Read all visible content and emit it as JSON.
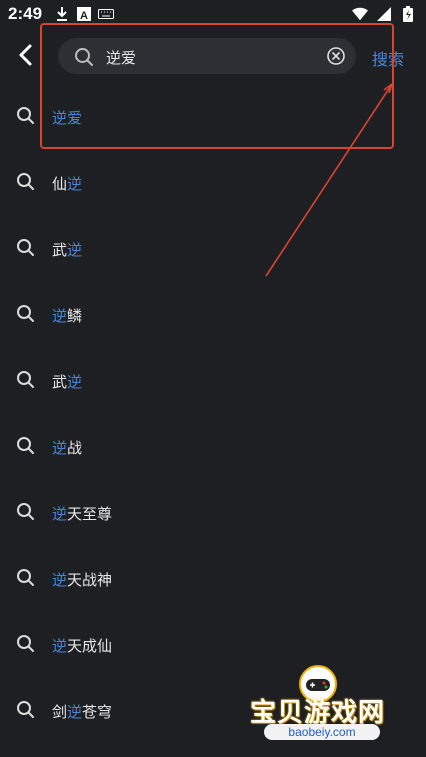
{
  "status": {
    "time": "2:49"
  },
  "search": {
    "value": "逆爱",
    "button_label": "搜索"
  },
  "suggestions": [
    {
      "prefix": "",
      "match": "逆爱",
      "suffix": ""
    },
    {
      "prefix": "仙",
      "match": "逆",
      "suffix": ""
    },
    {
      "prefix": "武",
      "match": "逆",
      "suffix": ""
    },
    {
      "prefix": "",
      "match": "逆",
      "suffix": "鳞"
    },
    {
      "prefix": "武",
      "match": "逆",
      "suffix": ""
    },
    {
      "prefix": "",
      "match": "逆",
      "suffix": "战"
    },
    {
      "prefix": "",
      "match": "逆",
      "suffix": "天至尊"
    },
    {
      "prefix": "",
      "match": "逆",
      "suffix": "天战神"
    },
    {
      "prefix": "",
      "match": "逆",
      "suffix": "天成仙"
    },
    {
      "prefix": "剑",
      "match": "逆",
      "suffix": "苍穹"
    }
  ],
  "watermark": {
    "title": "宝贝游戏网",
    "url": "baobeiy.com"
  },
  "colors": {
    "background": "#1e1f23",
    "accent": "#4a86d6",
    "annotation": "#d9442f"
  }
}
